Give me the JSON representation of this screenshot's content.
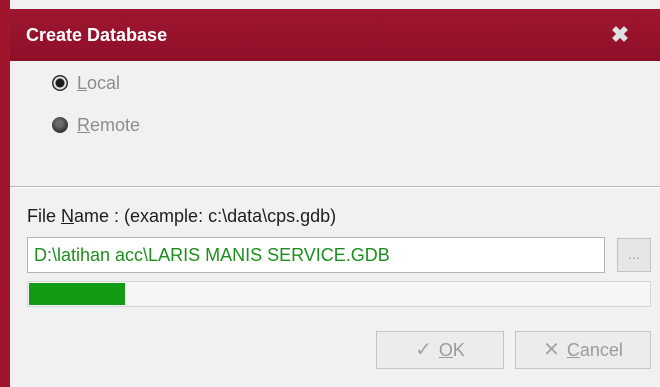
{
  "dialog": {
    "title": "Create Database",
    "close_icon": "close-icon"
  },
  "location": {
    "local": {
      "first": "L",
      "rest": "ocal",
      "checked": true
    },
    "remote": {
      "first": "R",
      "rest": "emote",
      "checked": false
    }
  },
  "file": {
    "label_pre": "File ",
    "label_key": "N",
    "label_post": "ame :  (example: c:\\data\\cps.gdb)",
    "value": "D:\\latihan acc\\LARIS MANIS SERVICE.GDB",
    "browse_label": "..."
  },
  "progress": {
    "fraction": 0.155,
    "color": "#139b16"
  },
  "buttons": {
    "ok": {
      "key": "O",
      "rest": "K",
      "icon": "check-icon"
    },
    "cancel": {
      "key": "C",
      "rest": "ancel",
      "icon": "cancel-icon"
    }
  },
  "colors": {
    "title_bar": "#9e1630",
    "input_text": "#1c8f1c",
    "disabled_text": "#9b9b9b"
  }
}
